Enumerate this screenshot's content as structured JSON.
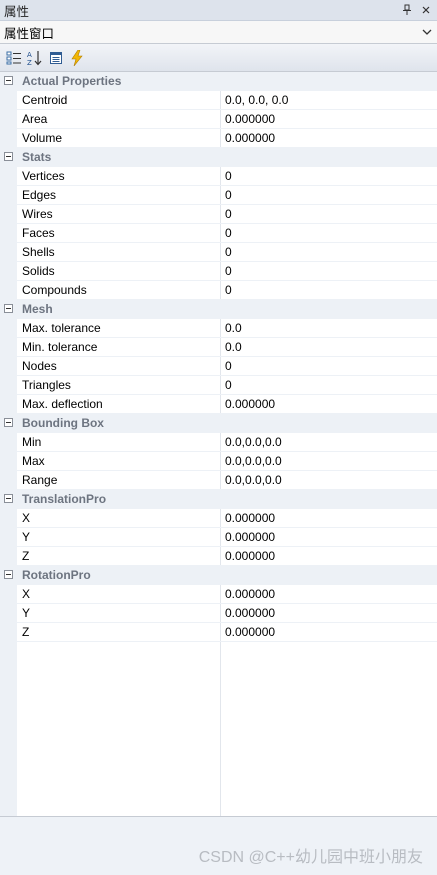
{
  "window": {
    "title": "属性"
  },
  "combo": {
    "value": "属性窗口"
  },
  "toolbar": {
    "buttons": [
      {
        "icon": "categorized-icon"
      },
      {
        "icon": "sort-alphabetical-icon"
      },
      {
        "icon": "property-pages-icon"
      },
      {
        "icon": "events-lightning-icon"
      }
    ]
  },
  "categories": [
    {
      "name": "Actual Properties",
      "props": [
        {
          "name": "Centroid",
          "value": "0.0, 0.0, 0.0"
        },
        {
          "name": "Area",
          "value": "0.000000"
        },
        {
          "name": "Volume",
          "value": "0.000000"
        }
      ]
    },
    {
      "name": "Stats",
      "props": [
        {
          "name": "Vertices",
          "value": "0"
        },
        {
          "name": "Edges",
          "value": "0"
        },
        {
          "name": "Wires",
          "value": "0"
        },
        {
          "name": "Faces",
          "value": "0"
        },
        {
          "name": "Shells",
          "value": "0"
        },
        {
          "name": "Solids",
          "value": "0"
        },
        {
          "name": "Compounds",
          "value": "0"
        }
      ]
    },
    {
      "name": "Mesh",
      "props": [
        {
          "name": "Max. tolerance",
          "value": "0.0"
        },
        {
          "name": "Min. tolerance",
          "value": "0.0"
        },
        {
          "name": "Nodes",
          "value": "0"
        },
        {
          "name": "Triangles",
          "value": "0"
        },
        {
          "name": "Max. deflection",
          "value": "0.000000"
        }
      ]
    },
    {
      "name": "Bounding Box",
      "props": [
        {
          "name": "Min",
          "value": "0.0,0.0,0.0"
        },
        {
          "name": "Max",
          "value": "0.0,0.0,0.0"
        },
        {
          "name": "Range",
          "value": "0.0,0.0,0.0"
        }
      ]
    },
    {
      "name": "TranslationPro",
      "props": [
        {
          "name": "X",
          "value": "0.000000"
        },
        {
          "name": "Y",
          "value": "0.000000"
        },
        {
          "name": "Z",
          "value": "0.000000"
        }
      ]
    },
    {
      "name": "RotationPro",
      "props": [
        {
          "name": "X",
          "value": "0.000000"
        },
        {
          "name": "Y",
          "value": "0.000000"
        },
        {
          "name": "Z",
          "value": "0.000000"
        }
      ]
    }
  ],
  "watermark": "CSDN @C++幼儿园中班小朋友"
}
